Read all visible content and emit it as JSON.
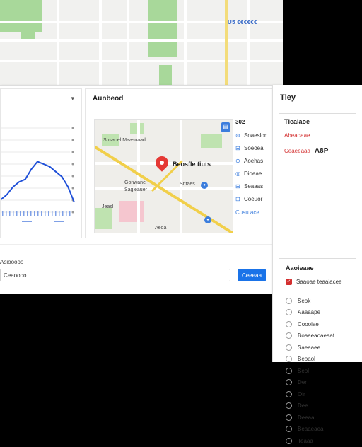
{
  "map_strip": {
    "label": "U5 €€€€€€"
  },
  "chart_card": {
    "dropdown_icon": "caret-down-icon"
  },
  "chart_data": {
    "type": "line",
    "x": [
      0,
      1,
      2,
      3,
      4,
      5,
      6,
      7,
      8,
      9,
      10,
      11,
      12
    ],
    "series": [
      {
        "values": [
          0.12,
          0.16,
          0.22,
          0.26,
          0.28,
          0.36,
          0.42,
          0.4,
          0.38,
          0.34,
          0.3,
          0.22,
          0.1
        ]
      }
    ],
    "color": "#1e4fd8",
    "grid": true
  },
  "map_card": {
    "header": "Aunbeod",
    "pin_label": "Beosfle tiuts",
    "street_labels": [
      "Snsaoel Maasoaad",
      "Gonwane",
      "Sagleauer",
      "Jeasl",
      "Sntaes",
      "Aeoa"
    ],
    "side_header": "302",
    "side_items": [
      "Soaeslor",
      "Soeoea",
      "Aoehas",
      "Dioeae",
      "Seaaas",
      "Coeuor"
    ],
    "more_link": "Cusu ace"
  },
  "form": {
    "label": "Asiooooo",
    "input_value": "Ceaoooo",
    "button": "Ceeeaa"
  },
  "right_panel": {
    "title": "Tley",
    "box_title": "Tleaiaoe",
    "row1": "Abeaoaae",
    "row2_label": "Ceaeeaaa",
    "row2_value": "A8P",
    "section_title": "Aaoieaae",
    "checked_item": "Saaoae teaaiacee",
    "options": [
      "Seok",
      "Aaaaape",
      "Coooiae",
      "Boaaeaoaeaat",
      "Saeaaee",
      "Beoaol",
      "Seol",
      "Der",
      "Oir",
      "Dee",
      "Deeaa",
      "Beaaeaea",
      "Teaaa"
    ]
  }
}
